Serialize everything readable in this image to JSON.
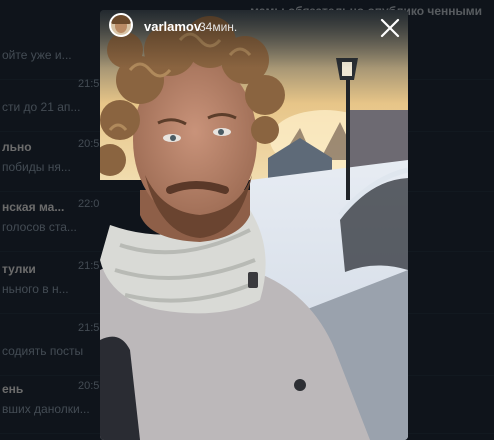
{
  "chat_list": {
    "header_text": "мамы обязательно опублико ченными",
    "rows": [
      {
        "name": "",
        "message": "ойте уже и...",
        "time": ""
      },
      {
        "name": "",
        "message": "сти до 21 ап...",
        "time": "21:5"
      },
      {
        "name": "льно",
        "message": "побиды ня...",
        "time": "20:5"
      },
      {
        "name": "нская ма...",
        "message": "голосов ста...",
        "time": "22:0"
      },
      {
        "name": "тулки",
        "message": "ньного в н...",
        "time": "21:5"
      },
      {
        "name": "",
        "message": "содиять посты",
        "time": "21:5"
      },
      {
        "name": "ень",
        "message": "вших данолки...",
        "time": "20:5"
      }
    ]
  },
  "story": {
    "username": "varlamov",
    "time_ago": "34мин.",
    "avatar_icon": "avatar-icon",
    "close_icon": "close-icon",
    "colors": {
      "sky_top": "#4d5a63",
      "sky_glow": "#e8c98a",
      "snow": "#e4e9f0",
      "jacket": "#b9b6b8",
      "scarf": "#d6d7d4",
      "hair": "#8a6440",
      "skin": "#b8836a"
    }
  }
}
